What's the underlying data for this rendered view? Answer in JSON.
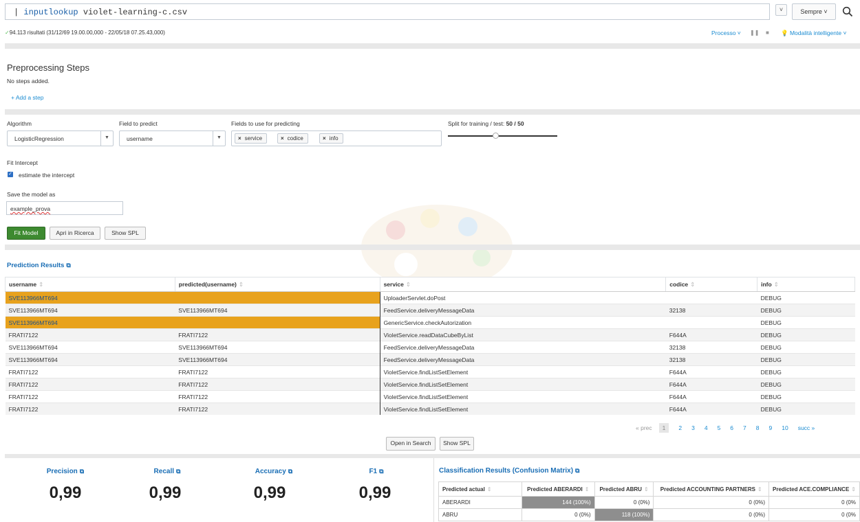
{
  "search": {
    "command": "| inputlookup violet-learning-c.csv",
    "time_caret": "˅",
    "time_range": "Sempre ˅",
    "search_icon": "search-icon"
  },
  "status": {
    "results": "94.113 risultati (31/12/69 19.00.00,000 - 22/05/18 07.25.43,000)",
    "process": "Processo ˅",
    "smart_mode": "Modalità intelligente ˅"
  },
  "preprocessing": {
    "title": "Preprocessing Steps",
    "empty": "No steps added.",
    "add": "+ Add a step"
  },
  "form": {
    "algorithm_label": "Algorithm",
    "algorithm_value": "LogisticRegression",
    "field_label": "Field to predict",
    "field_value": "username",
    "fields_label": "Fields to use for predicting",
    "fields": [
      "service",
      "codice",
      "info"
    ],
    "split_label": "Split for training / test: ",
    "split_value": "50 / 50",
    "split_fraction": 0.5,
    "fit_label": "Fit Intercept",
    "fit_check_label": "estimate the intercept",
    "fit_checked": true,
    "save_label": "Save the model as",
    "save_value": "example_prova",
    "btn_fit": "Fit Model",
    "btn_apri": "Apri in Ricerca",
    "btn_spl": "Show SPL"
  },
  "prediction": {
    "title": "Prediction Results",
    "columns": [
      "username",
      "predicted(username)",
      "service",
      "codice",
      "info"
    ],
    "rows": [
      [
        "SVE113966MT694",
        "",
        "UploaderServlet.doPost",
        "",
        "DEBUG"
      ],
      [
        "SVE113966MT694",
        "SVE113966MT694",
        "FeedService.deliveryMessageData",
        "32138",
        "DEBUG"
      ],
      [
        "SVE113966MT694",
        "",
        "GenericService.checkAutorization",
        "",
        "DEBUG"
      ],
      [
        "FRATI7122",
        "FRATI7122",
        "VioletService.readDataCubeByList",
        "F644A",
        "DEBUG"
      ],
      [
        "SVE113966MT694",
        "SVE113966MT694",
        "FeedService.deliveryMessageData",
        "32138",
        "DEBUG"
      ],
      [
        "SVE113966MT694",
        "SVE113966MT694",
        "FeedService.deliveryMessageData",
        "32138",
        "DEBUG"
      ],
      [
        "FRATI7122",
        "FRATI7122",
        "VioletService.findListSetElement",
        "F644A",
        "DEBUG"
      ],
      [
        "FRATI7122",
        "FRATI7122",
        "VioletService.findListSetElement",
        "F644A",
        "DEBUG"
      ],
      [
        "FRATI7122",
        "FRATI7122",
        "VioletService.findListSetElement",
        "F644A",
        "DEBUG"
      ],
      [
        "FRATI7122",
        "FRATI7122",
        "VioletService.findListSetElement",
        "F644A",
        "DEBUG"
      ]
    ],
    "highlight_rows": [
      0,
      2
    ],
    "highlight_color": "#e8a21d",
    "pager": {
      "prev": "« prec",
      "pages": [
        "1",
        "2",
        "3",
        "4",
        "5",
        "6",
        "7",
        "8",
        "9",
        "10"
      ],
      "next": "succ »"
    },
    "btn_open": "Open in Search",
    "btn_spl": "Show SPL"
  },
  "metrics": [
    {
      "label": "Precision",
      "value": "0,99"
    },
    {
      "label": "Recall",
      "value": "0,99"
    },
    {
      "label": "Accuracy",
      "value": "0,99"
    },
    {
      "label": "F1",
      "value": "0,99"
    }
  ],
  "confusion": {
    "title": "Classification Results (Confusion Matrix)",
    "columns": [
      "Predicted actual",
      "Predicted ABERARDI",
      "Predicted ABRU",
      "Predicted ACCOUNTING PARTNERS",
      "Predicted ACE.COMPLIANCE"
    ],
    "rows": [
      [
        "ABERARDI",
        "144 (100%)",
        "0 (0%)",
        "0 (0%)",
        "0 (0%"
      ],
      [
        "ABRU",
        "0 (0%)",
        "118 (100%)",
        "0 (0%)",
        "0 (0%"
      ]
    ]
  },
  "colors": {
    "accent": "#1a6eb5",
    "link": "#1a8bd1",
    "fit_button": "#3d8a30"
  }
}
